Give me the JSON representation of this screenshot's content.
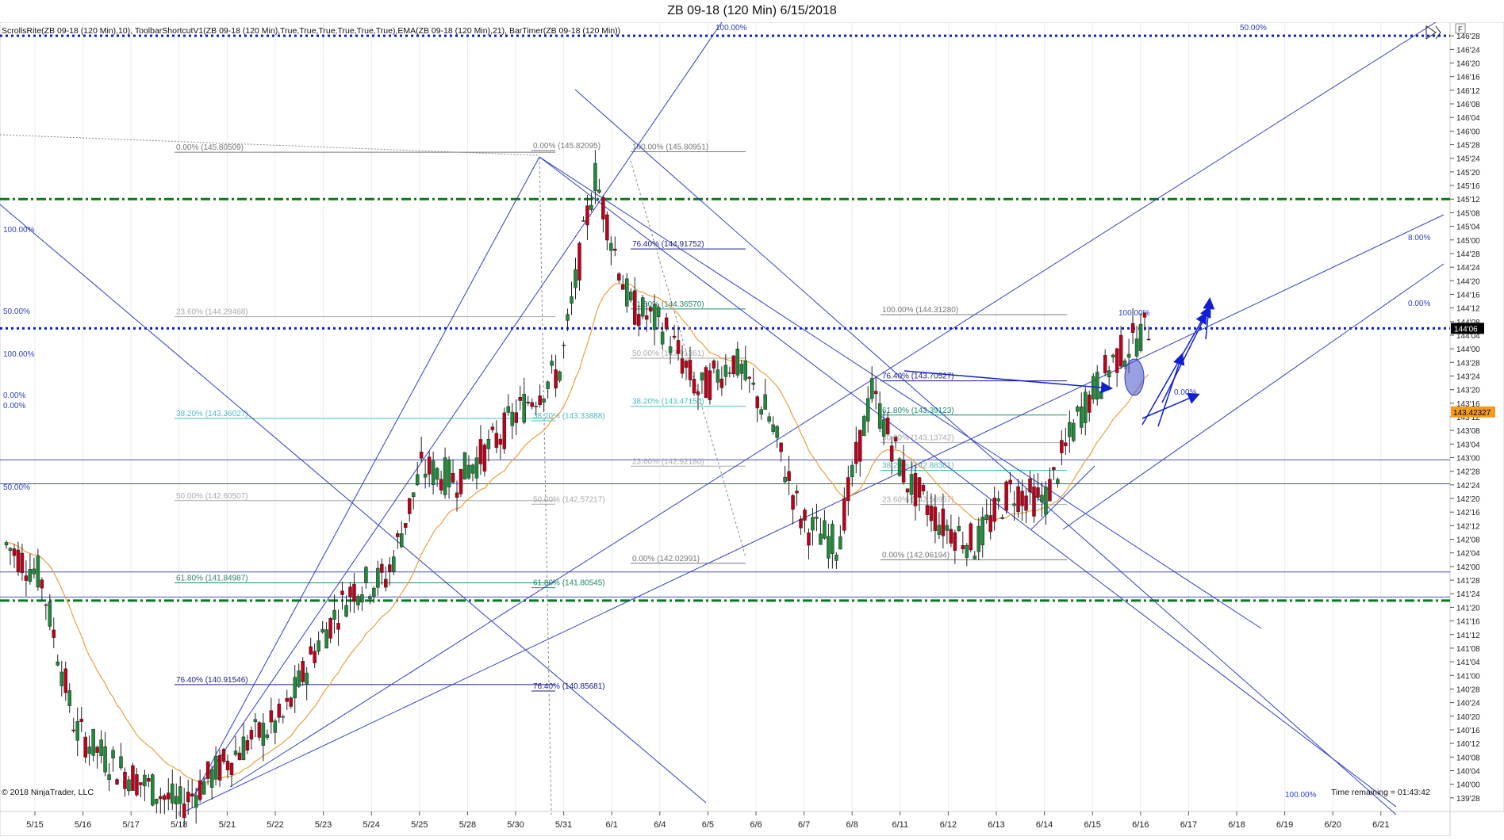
{
  "window": {
    "title": "ZB 09-18 (120 Min)  6/15/2018"
  },
  "indicators_label": "ScrollsRite(ZB 09-18 (120 Min),10), ToolbarShortcutV1(ZB 09-18 (120 Min),True,True,True,True,True,True),EMA(ZB 09-18 (120 Min),21), BarTimer(ZB 09-18 (120 Min))",
  "copyright": "© 2018 NinjaTrader, LLC",
  "time_remaining": "Time remaining = 01:43:42",
  "toolbar_icon": "F",
  "price_axis": {
    "tick_labels": [
      "146'28",
      "146'24",
      "146'20",
      "146'16",
      "146'12",
      "146'08",
      "146'04",
      "146'00",
      "145'28",
      "145'24",
      "145'20",
      "145'16",
      "145'12",
      "145'08",
      "145'04",
      "145'00",
      "144'28",
      "144'24",
      "144'20",
      "144'16",
      "144'12",
      "144'08",
      "144'04",
      "144'00",
      "143'28",
      "143'24",
      "143'20",
      "143'16",
      "143'12",
      "143'08",
      "143'04",
      "143'00",
      "142'28",
      "142'24",
      "142'20",
      "142'16",
      "142'12",
      "142'08",
      "142'04",
      "142'00",
      "141'28",
      "141'24",
      "141'20",
      "141'16",
      "141'12",
      "141'08",
      "141'04",
      "141'00",
      "140'28",
      "140'24",
      "140'20",
      "140'16",
      "140'12",
      "140'08",
      "140'04",
      "140'00",
      "139'28",
      "139'24"
    ],
    "current_price_label": "144'06",
    "ema_value_label": "143.42327",
    "current_price_color": "#000000",
    "ema_value_color": "#f29c1f"
  },
  "date_axis": {
    "labels": [
      "5/15",
      "5/16",
      "5/17",
      "5/18",
      "5/21",
      "5/22",
      "5/23",
      "5/24",
      "5/25",
      "5/28",
      "5/30",
      "5/31",
      "6/1",
      "6/4",
      "6/5",
      "6/6",
      "6/7",
      "6/8",
      "6/11",
      "6/12",
      "6/13",
      "6/14",
      "6/15",
      "6/16",
      "6/17",
      "6/18",
      "6/19",
      "6/20",
      "6/21"
    ]
  },
  "fib_labels": [
    {
      "text": "0.00% (145.80509)",
      "color": "#777"
    },
    {
      "text": "23.60% (144.29468)",
      "color": "#aaa"
    },
    {
      "text": "38.20% (143.36027)",
      "color": "#4bbfbf"
    },
    {
      "text": "50.00% (142.60507)",
      "color": "#aaa"
    },
    {
      "text": "61.80% (141.84987)",
      "color": "#1f8a70"
    },
    {
      "text": "76.40% (140.91546)",
      "color": "#1a1a8a"
    },
    {
      "text": "0.00% (145.82095)",
      "color": "#777"
    },
    {
      "text": "38.20% (143.33888)",
      "color": "#4bbfbf"
    },
    {
      "text": "50.00% (142.57217)",
      "color": "#aaa"
    },
    {
      "text": "61.80% (141.80545)",
      "color": "#1f8a70"
    },
    {
      "text": "76.40% (140.85681)",
      "color": "#1a1a8a"
    },
    {
      "text": "100.00% (145.80951)",
      "color": "#777"
    },
    {
      "text": "76.40% (144.91752)",
      "color": "#1a1a8a"
    },
    {
      "text": "61.80% (144.36570)",
      "color": "#1f8a70"
    },
    {
      "text": "50.00% (143.91361)",
      "color": "#aaa"
    },
    {
      "text": "38.20% (143.47150)",
      "color": "#4bbfbf"
    },
    {
      "text": "23.60% (142.92180)",
      "color": "#aaa"
    },
    {
      "text": "0.00% (142.02991)",
      "color": "#777"
    },
    {
      "text": "100.00% (144.31280)",
      "color": "#777"
    },
    {
      "text": "76.40% (143.70527)",
      "color": "#1a1a8a"
    },
    {
      "text": "61.80% (143.39123)",
      "color": "#1f8a70"
    },
    {
      "text": "50.00% (143.13742)",
      "color": "#aaa"
    },
    {
      "text": "38.20% (142.88361)",
      "color": "#4bbfbf"
    },
    {
      "text": "23.60% (142.56957)",
      "color": "#aaa"
    },
    {
      "text": "0.00% (142.06194)",
      "color": "#777"
    }
  ],
  "pitchfork_labels": [
    "100.00%",
    "50.00%",
    "100.00%",
    "50.00%",
    "100.00%",
    "0.00%",
    "0.00%",
    "50.00%",
    "100.00%",
    "0.00%",
    "8.00%",
    "0.00%",
    "100.00%"
  ],
  "colors": {
    "up_candle": "#1f8a3a",
    "down_candle": "#c0001a",
    "ema": "#e8a040",
    "pitchfork": "#3040c0",
    "dotted_level": "#0a1ccc",
    "green_level": "#0a7a1a",
    "horiz_line": "#4050c0",
    "dotted_gray": "#888888"
  },
  "chart_data": {
    "type": "candlestick",
    "title": "ZB 09-18 (120 Min)  6/15/2018",
    "y_range": [
      139.75,
      147.0
    ],
    "key_levels": [
      {
        "kind": "dotted-blue",
        "price": 146.875
      },
      {
        "kind": "green-dashdot",
        "price": 145.375
      },
      {
        "kind": "dotted-blue",
        "price": 144.1875
      },
      {
        "kind": "green-dashdot",
        "price": 141.6875
      }
    ],
    "closes_approx": [
      142.2,
      141.9,
      140.5,
      140.2,
      140.0,
      139.8,
      140.1,
      140.4,
      140.6,
      141.3,
      141.8,
      141.9,
      142.9,
      142.8,
      143.1,
      143.5,
      143.8,
      145.6,
      144.4,
      144.2,
      143.6,
      143.9,
      143.4,
      142.4,
      142.2,
      143.6,
      142.8,
      142.4,
      142.2,
      142.7,
      142.6,
      143.4,
      143.9,
      144.2
    ]
  }
}
